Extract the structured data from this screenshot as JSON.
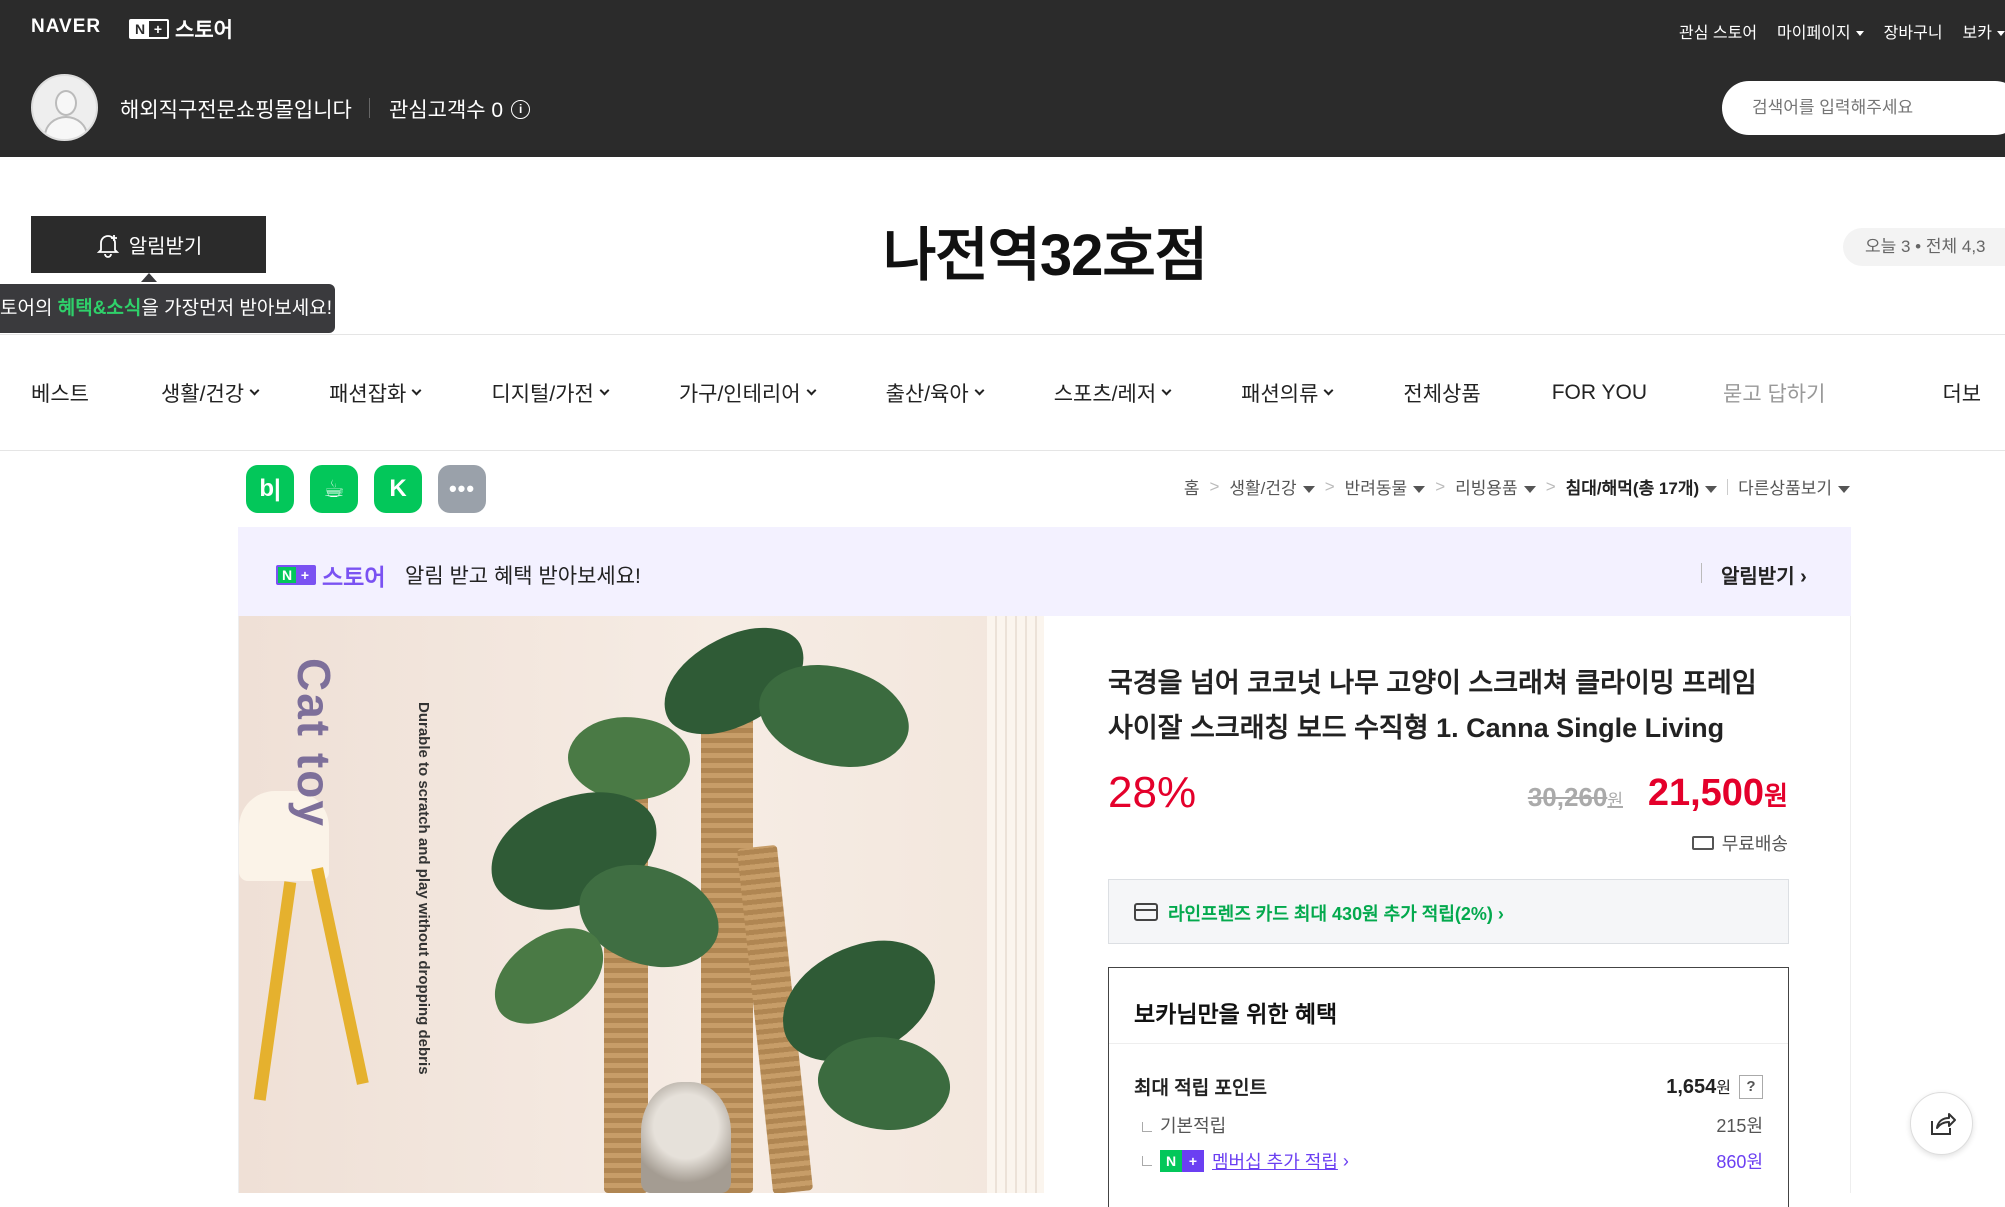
{
  "topbar": {
    "naver_logo": "NAVER",
    "nplus_n": "N",
    "nplus_plus": "+",
    "nplus_store": "스토어",
    "links": [
      "관심 스토어",
      "마이페이지",
      "장바구니",
      "보카"
    ]
  },
  "store": {
    "name": "해외직구전문쇼핑몰입니다",
    "fav_label": "관심고객수 0",
    "search_placeholder": "검색어를 입력해주세요",
    "title": "나전역32호점",
    "alarm_button": "알림받기",
    "tooltip_pre": "토어의 ",
    "tooltip_highlight": "혜택&소식",
    "tooltip_post": "을 가장먼저 받아보세요!",
    "visits": "오늘 3 • 전체 4,3"
  },
  "categories": [
    {
      "label": "베스트",
      "dropdown": false
    },
    {
      "label": "생활/건강",
      "dropdown": true
    },
    {
      "label": "패션잡화",
      "dropdown": true
    },
    {
      "label": "디지털/가전",
      "dropdown": true
    },
    {
      "label": "가구/인테리어",
      "dropdown": true
    },
    {
      "label": "출산/육아",
      "dropdown": true
    },
    {
      "label": "스포츠/레저",
      "dropdown": true
    },
    {
      "label": "패션의류",
      "dropdown": true
    },
    {
      "label": "전체상품",
      "dropdown": false
    },
    {
      "label": "FOR YOU",
      "dropdown": false
    },
    {
      "label": "묻고 답하기",
      "dropdown": false
    },
    {
      "label": "더보",
      "dropdown": false
    }
  ],
  "apps": [
    "b|",
    "☕",
    "K",
    "•••"
  ],
  "breadcrumb": {
    "home": "홈",
    "items": [
      "생활/건강",
      "반려동물",
      "리빙용품"
    ],
    "current": "침대/해먹(총 17개)",
    "other": "다른상품보기"
  },
  "promo": {
    "brand": "스토어",
    "text": "알림 받고 혜택 받아보세요!",
    "link": "알림받기"
  },
  "image": {
    "title_text": "Cat toy",
    "note": "Durable to scratch and play without dropping debris"
  },
  "product": {
    "title": "국경을 넘어 코코넛 나무 고양이 스크래쳐 클라이밍 프레임 사이잘 스크래칭 보드 수직형 1. Canna Single Living",
    "discount": "28%",
    "original_price": "30,260",
    "price": "21,500",
    "won": "원",
    "shipping": "무료배송",
    "card_promo": "라인프렌즈 카드 최대 430원 추가 적립(2%)",
    "benefit_title": "보카님만을 위한 혜택",
    "max_points_label": "최대 적립 포인트",
    "max_points_value": "1,654",
    "base_label": "기본적립",
    "base_value": "215원",
    "member_label": "멤버십 추가 적립",
    "member_value": "860원"
  },
  "colors": {
    "naver_green": "#03c75a",
    "nplus_purple": "#7a52f2",
    "sale_red": "#e4002b",
    "dark_bar": "#2b2b2b"
  }
}
